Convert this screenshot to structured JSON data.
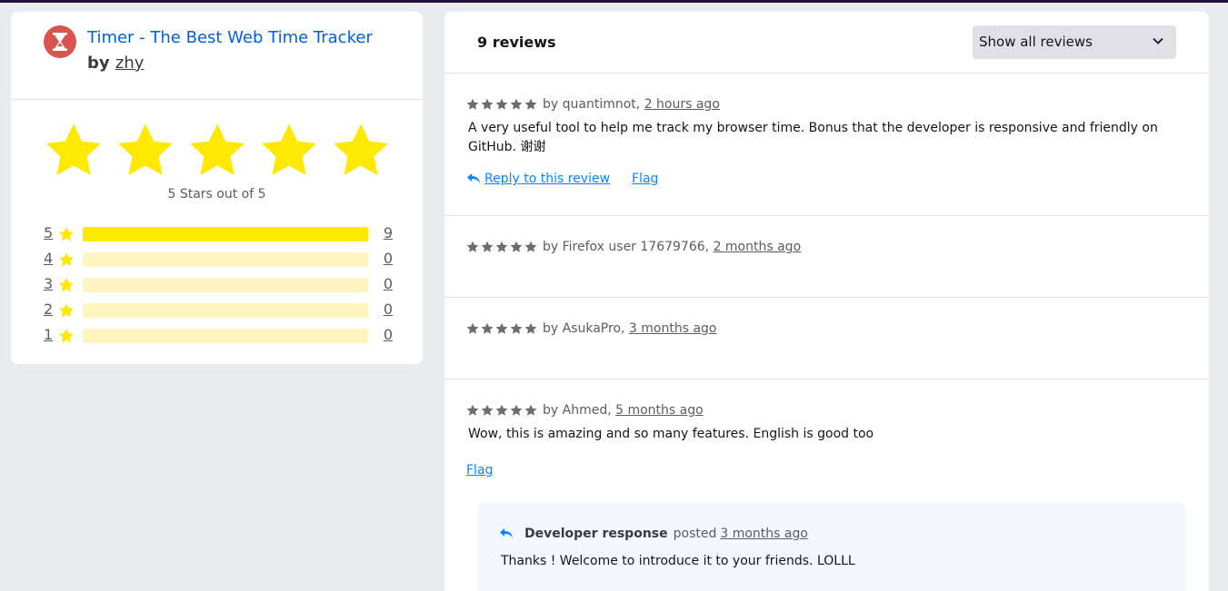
{
  "addon": {
    "title": "Timer - The Best Web Time Tracker",
    "by_label": "by",
    "author": "zhy",
    "rating_text": "5 Stars out of 5",
    "icon": "hourglass-icon",
    "colors": {
      "title": "#0061e0",
      "star": "#ffe900",
      "bar_empty": "#fff4bf",
      "icon_bg": "#d9534f"
    }
  },
  "rating_bars": [
    {
      "stars": "5",
      "count": "9",
      "fraction": 1.0
    },
    {
      "stars": "4",
      "count": "0",
      "fraction": 0
    },
    {
      "stars": "3",
      "count": "0",
      "fraction": 0
    },
    {
      "stars": "2",
      "count": "0",
      "fraction": 0
    },
    {
      "stars": "1",
      "count": "0",
      "fraction": 0
    }
  ],
  "reviews_panel": {
    "count_label": "9 reviews",
    "filter_selected": "Show all reviews"
  },
  "reviews": [
    {
      "by": "by quantimnot,",
      "time": "2 hours ago",
      "body": "A very useful tool to help me track my browser time. Bonus that the developer is responsive and friendly on GitHub. 谢谢",
      "reply_label": "Reply to this review",
      "flag_label": "Flag"
    },
    {
      "by": "by Firefox user 17679766,",
      "time": "2 months ago"
    },
    {
      "by": "by AsukaPro,",
      "time": "3 months ago"
    },
    {
      "by": "by Ahmed,",
      "time": "5 months ago",
      "body": "Wow, this is amazing and so many features. English is good too",
      "flag_label": "Flag",
      "developer_response": {
        "title": "Developer response",
        "posted": "posted",
        "time": "3 months ago",
        "body": "Thanks ! Welcome to introduce it to your friends. LOLLL"
      }
    }
  ]
}
